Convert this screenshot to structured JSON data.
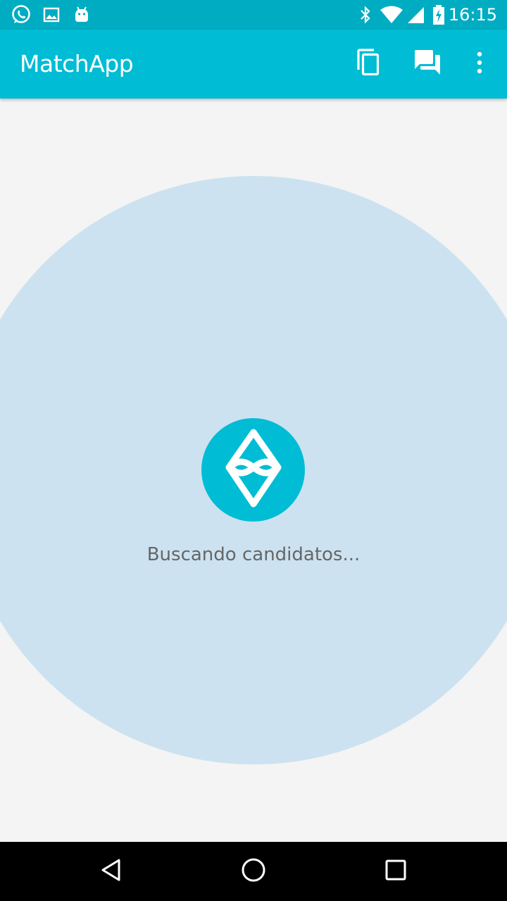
{
  "status_bar": {
    "time": "16:15",
    "notification_icons": [
      "whatsapp-icon",
      "image-icon",
      "android-icon"
    ],
    "system_icons": [
      "bluetooth-icon",
      "wifi-icon",
      "signal-icon",
      "battery-charging-icon"
    ]
  },
  "app_bar": {
    "title": "MatchApp",
    "actions": [
      "copy-icon",
      "chat-icon",
      "more-vert-icon"
    ]
  },
  "main": {
    "status_text": "Buscando candidatos...",
    "logo_icon": "matchapp-logo-icon"
  },
  "nav_bar": {
    "buttons": [
      "back-icon",
      "home-icon",
      "recents-icon"
    ]
  },
  "colors": {
    "status_bar": "#00acc1",
    "app_bar": "#00bcd4",
    "background": "#f4f4f4",
    "radar": "#cce2f0",
    "accent": "#00bcd4",
    "nav_bar": "#000000"
  }
}
